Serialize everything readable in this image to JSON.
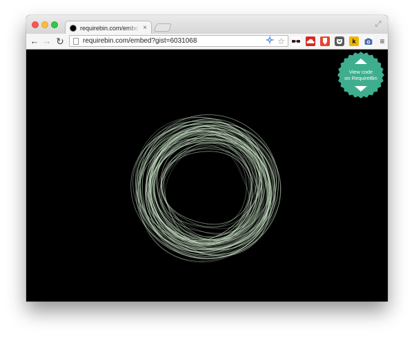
{
  "browser": {
    "tab": {
      "title": "requirebin.com/embed?gi",
      "close_icon": "×"
    },
    "address_bar": {
      "url": "requirebin.com/embed?gist=6031068"
    },
    "icons": {
      "back": "←",
      "forward": "→",
      "reload": "↻",
      "fullscreen": "⤢",
      "star": "☆",
      "menu": "≡"
    },
    "extensions": [
      "ghostery-icon",
      "cloud-icon",
      "lastpass-icon",
      "pocket-icon",
      "k-icon",
      "camera-icon"
    ]
  },
  "page": {
    "background_color": "#000000",
    "ring_color": "#cfe8cc",
    "badge": {
      "line1": "View code",
      "line2": "on RequireBin",
      "color": "#3fae8e"
    }
  }
}
